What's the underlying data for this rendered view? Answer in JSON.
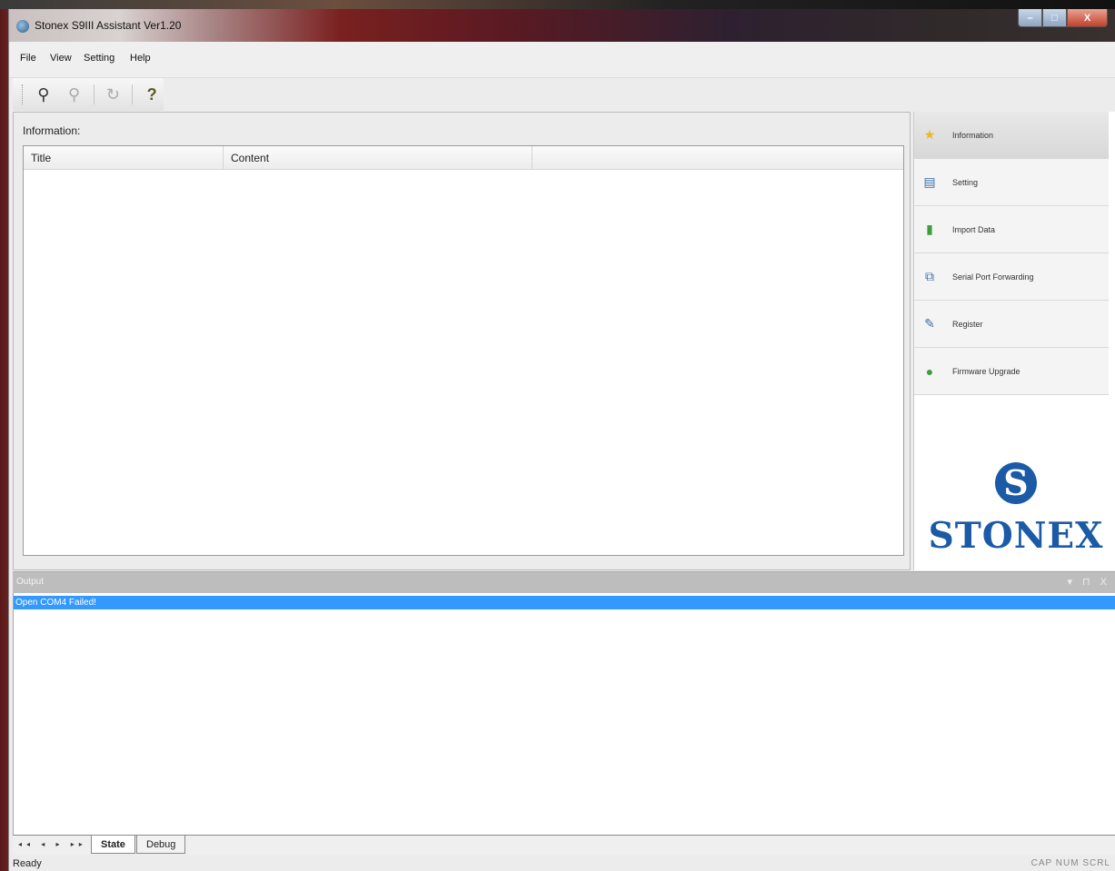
{
  "window": {
    "title": "Stonex S9III Assistant Ver1.20",
    "minimize_glyph": "–",
    "maximize_glyph": "□",
    "close_glyph": "X"
  },
  "menu": {
    "items": [
      "File",
      "View",
      "Setting",
      "Help"
    ]
  },
  "toolbar": {
    "buttons": [
      {
        "icon": "connect-icon",
        "glyph": "⚲"
      },
      {
        "icon": "disconnect-icon",
        "glyph": "⚲"
      },
      {
        "icon": "refresh-icon",
        "glyph": "↻"
      },
      {
        "icon": "help-icon",
        "glyph": "?"
      }
    ]
  },
  "main": {
    "info_label": "Information:",
    "columns": [
      "Title",
      "Content",
      ""
    ]
  },
  "sidebar": {
    "items": [
      {
        "label": "Information",
        "icon": "star-icon",
        "glyph": "★",
        "color": "#e8b923"
      },
      {
        "label": "Setting",
        "icon": "settings-icon",
        "glyph": "▤",
        "color": "#3b6ea8"
      },
      {
        "label": "Import Data",
        "icon": "import-icon",
        "glyph": "▮",
        "color": "#3aa13a"
      },
      {
        "label": "Serial Port Forwarding",
        "icon": "serial-port-icon",
        "glyph": "⧉",
        "color": "#3b6ea8"
      },
      {
        "label": "Register",
        "icon": "register-icon",
        "glyph": "✎",
        "color": "#3b6ea8"
      },
      {
        "label": "Firmware Upgrade",
        "icon": "upgrade-icon",
        "glyph": "●",
        "color": "#3aa13a"
      }
    ],
    "logo_mark": "S",
    "logo_text": "STONEX"
  },
  "output": {
    "title": "Output",
    "controls": "▾ ⊓ X",
    "lines": [
      "Open COM4 Failed!"
    ]
  },
  "tabs": {
    "nav": "◂◂ ◂ ▸ ▸▸",
    "items": [
      "State",
      "Debug"
    ]
  },
  "status": {
    "left": "Ready",
    "right": "CAP NUM SCRL"
  }
}
